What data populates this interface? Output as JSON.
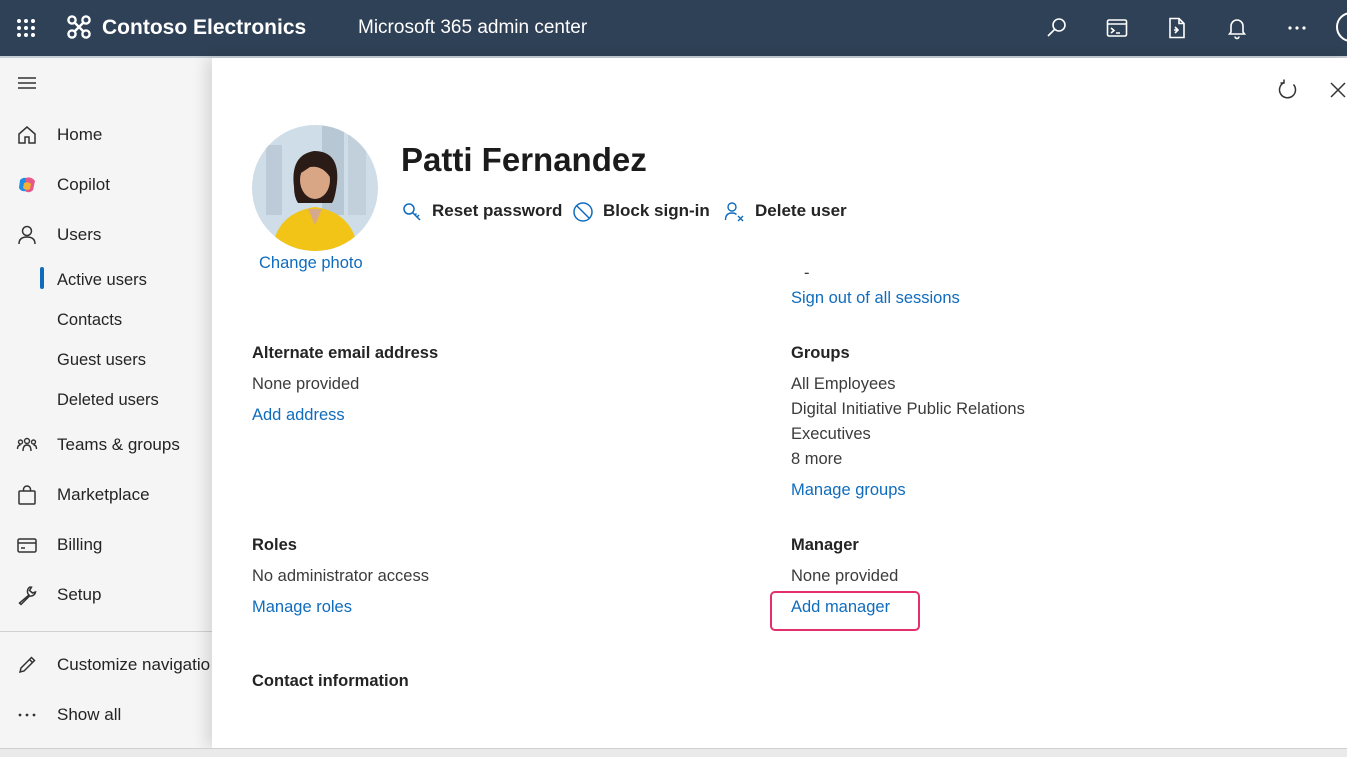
{
  "topbar": {
    "org_name": "Contoso Electronics",
    "app_name": "Microsoft 365 admin center",
    "icons": [
      "app-launcher-icon",
      "contoso-logo-icon",
      "search-icon",
      "terminal-icon",
      "document-icon",
      "bell-icon",
      "more-icon",
      "avatar"
    ]
  },
  "nav": {
    "items": [
      {
        "label": "Home",
        "icon": "home-icon"
      },
      {
        "label": "Copilot",
        "icon": "copilot-icon"
      },
      {
        "label": "Users",
        "icon": "person-icon"
      },
      {
        "label": "Active users",
        "sub": true,
        "selected": true
      },
      {
        "label": "Contacts",
        "sub": true
      },
      {
        "label": "Guest users",
        "sub": true
      },
      {
        "label": "Deleted users",
        "sub": true
      },
      {
        "label": "Teams & groups",
        "icon": "people-team-icon"
      },
      {
        "label": "Marketplace",
        "icon": "shopping-bag-icon"
      },
      {
        "label": "Billing",
        "icon": "credit-card-icon"
      },
      {
        "label": "Setup",
        "icon": "wrench-icon"
      },
      {
        "label": "Customize navigatio",
        "icon": "edit-icon"
      },
      {
        "label": "Show all",
        "icon": "more-icon"
      }
    ]
  },
  "user": {
    "name": "Patti Fernandez",
    "change_photo": "Change photo",
    "actions": {
      "reset_password": "Reset password",
      "block_signin": "Block sign-in",
      "delete_user": "Delete user"
    }
  },
  "details": {
    "dash": "-",
    "sign_out": "Sign out of all sessions",
    "alt_email": {
      "heading": "Alternate email address",
      "value": "None provided",
      "link": "Add address"
    },
    "groups": {
      "heading": "Groups",
      "items": [
        "All Employees",
        "Digital Initiative Public Relations",
        "Executives",
        "8 more"
      ],
      "link": "Manage groups"
    },
    "roles": {
      "heading": "Roles",
      "value": "No administrator access",
      "link": "Manage roles"
    },
    "manager": {
      "heading": "Manager",
      "value": "None provided",
      "link": "Add manager"
    },
    "contact": {
      "heading": "Contact information"
    }
  },
  "colors": {
    "topbar": "#2f4156",
    "link": "#0f6cbd",
    "highlight": "#e3306b",
    "nav_bg": "#f5f5f5"
  }
}
